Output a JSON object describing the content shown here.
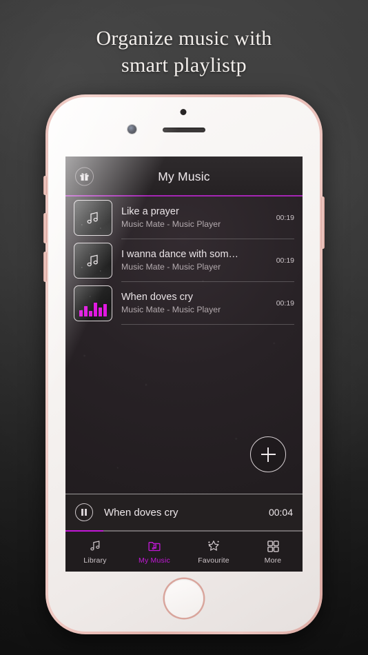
{
  "promo": {
    "headline_line1": "Organize music with",
    "headline_line2": "smart playlistp"
  },
  "colors": {
    "accent": "#c318d8",
    "accent_bright": "#e018e0",
    "header_rule": "#a526b5",
    "app_bg": "#241f22",
    "bezel": "#eec5bf"
  },
  "app": {
    "header": {
      "title": "My Music",
      "left_icon": "gift-icon"
    },
    "tracks": [
      {
        "title": "Like a prayer",
        "subtitle": "Music Mate - Music Player",
        "duration": "00:19",
        "artwork": "music-note-icon",
        "playing": false
      },
      {
        "title": "I wanna dance with som…",
        "subtitle": "Music Mate - Music Player",
        "duration": "00:19",
        "artwork": "music-note-icon",
        "playing": false
      },
      {
        "title": "When doves cry",
        "subtitle": "Music Mate - Music Player",
        "duration": "00:19",
        "artwork": "equalizer-icon",
        "playing": true
      }
    ],
    "fab": {
      "label": "+",
      "icon": "plus-icon"
    },
    "now_playing": {
      "title": "When doves cry",
      "elapsed": "00:04",
      "state": "playing",
      "control_icon": "pause-icon",
      "progress_percent": 16
    },
    "tabs": [
      {
        "label": "Library",
        "icon": "music-note-icon",
        "active": false
      },
      {
        "label": "My Music",
        "icon": "music-folder-icon",
        "active": true
      },
      {
        "label": "Favourite",
        "icon": "sparkle-star-icon",
        "active": false
      },
      {
        "label": "More",
        "icon": "grid-icon",
        "active": false
      }
    ]
  },
  "device": {
    "type": "smartphone",
    "finish": "rose-gold",
    "home_button": "home-button",
    "buttons": [
      "silent-switch",
      "volume-up-button",
      "volume-down-button",
      "power-button"
    ]
  }
}
